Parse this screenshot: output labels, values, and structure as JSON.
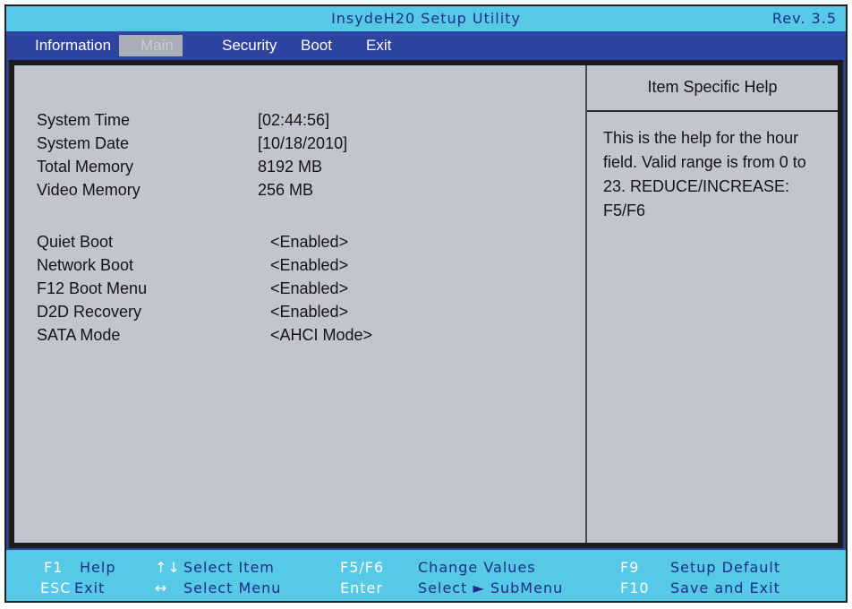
{
  "title": "InsydeH20 Setup Utility",
  "revision": "Rev. 3.5",
  "menu": [
    {
      "label": "Information"
    },
    {
      "label": "Main"
    },
    {
      "label": "Security"
    },
    {
      "label": "Boot"
    },
    {
      "label": "Exit"
    }
  ],
  "active_menu": "Main",
  "info": [
    {
      "label": "System Time",
      "value": "[02:44:56]"
    },
    {
      "label": "System Date",
      "value": "[10/18/2010]"
    },
    {
      "label": "Total Memory",
      "value": "8192 MB"
    },
    {
      "label": "Video Memory",
      "value": "256 MB"
    }
  ],
  "settings": [
    {
      "label": "Quiet Boot",
      "value": "<Enabled>"
    },
    {
      "label": "Network Boot",
      "value": "<Enabled>"
    },
    {
      "label": "F12 Boot Menu",
      "value": "<Enabled>"
    },
    {
      "label": "D2D Recovery",
      "value": "<Enabled>"
    },
    {
      "label": "SATA Mode",
      "value": "<AHCI Mode>"
    }
  ],
  "help": {
    "title": "Item Specific Help",
    "lines": [
      "This is the help for the hour",
      "field. Valid range is from 0 to",
      "23. REDUCE/INCREASE:",
      "F5/F6"
    ]
  },
  "footer": {
    "f1_key": "F1",
    "f1_desc": "Help",
    "esc_key": "ESC",
    "esc_desc": "Exit",
    "updown_key": "↑↓",
    "updown_desc": "Select  Item",
    "leftright_key": "↔",
    "leftright_desc": "Select  Menu",
    "f5f6_key": "F5/F6",
    "f5f6_desc": "Change  Values",
    "enter_key": "Enter",
    "enter_desc": "Select  ► SubMenu",
    "f9_key": "F9",
    "f9_desc": "Setup  Default",
    "f10_key": "F10",
    "f10_desc": "Save  and  Exit"
  }
}
